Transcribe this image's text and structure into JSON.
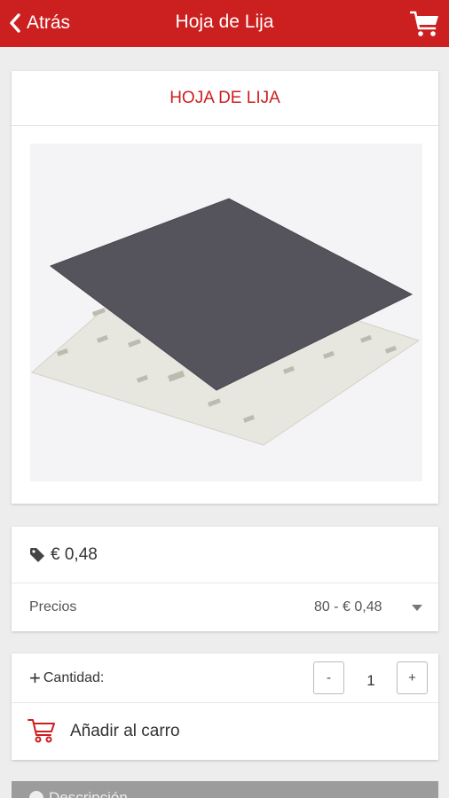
{
  "header": {
    "back_label": "Atrás",
    "title": "Hoja de Lija",
    "back_icon": "chevron-left-icon",
    "cart_icon": "shopping-cart-icon",
    "bar_color": "#cc1f1f"
  },
  "product": {
    "name": "HOJA DE LIJA",
    "carousel_pages": 1,
    "carousel_current": 1
  },
  "pricing": {
    "price": "€ 0,48",
    "price_icon": "tag-icon",
    "prices_label": "Precios",
    "prices_selected": "80 - € 0,48"
  },
  "quantity": {
    "label": "Cantidad:",
    "minus_label": "-",
    "value": "1",
    "plus_label": "+"
  },
  "cart": {
    "add_label": "Añadir al carro",
    "add_icon": "shopping-cart-icon"
  },
  "description": {
    "label": "Descripción"
  }
}
